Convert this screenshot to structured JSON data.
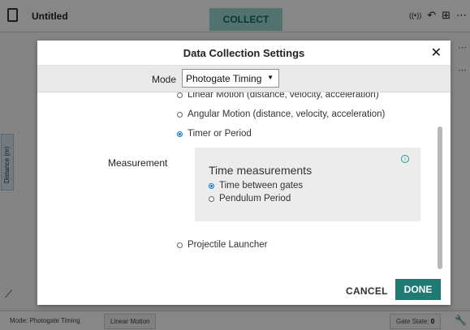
{
  "app": {
    "title": "Untitled",
    "collect_label": "COLLECT",
    "y_axis_label": "Distance (m)",
    "status": {
      "mode_text": "Mode: Photogate Timing",
      "motion_text": "Linear Motion",
      "gate_state_label": "Gate State:",
      "gate_state_value": "0"
    },
    "icons": [
      "document-icon",
      "wireless-icon",
      "undo-icon",
      "layout-icon",
      "more-icon",
      "graph-tool-icon",
      "wrench-icon"
    ]
  },
  "dialog": {
    "title": "Data Collection Settings",
    "mode_label": "Mode",
    "mode_selected": "Photogate Timing",
    "options": {
      "linear": "Linear Motion (distance, velocity, acceleration)",
      "angular": "Angular Motion (distance, velocity, acceleration)",
      "timer": "Timer or Period",
      "projectile": "Projectile Launcher"
    },
    "selected_option": "Timer or Period",
    "measurement_label": "Measurement",
    "panel": {
      "title": "Time measurements",
      "option_gates": "Time between gates",
      "option_pendulum": "Pendulum Period",
      "selected": "Time between gates"
    },
    "cancel_label": "CANCEL",
    "done_label": "DONE"
  },
  "colors": {
    "accent": "#1f7a74",
    "collect_bg": "#9ad7d2",
    "radio_selected": "#1a73c8"
  }
}
